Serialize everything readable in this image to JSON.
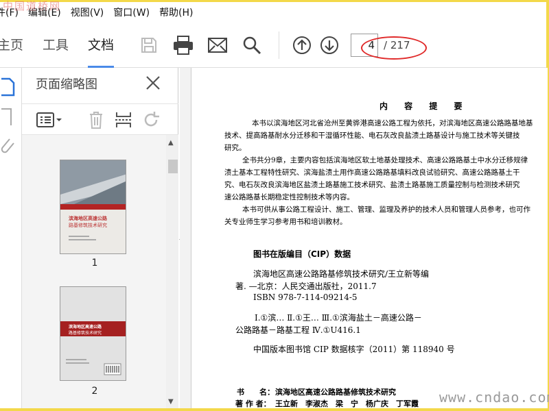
{
  "watermark_top": "中国道桥网",
  "watermark_bottom": "www.cndao.com",
  "menu": [
    "件(F)",
    "编辑(E)",
    "视图(V)",
    "窗口(W)",
    "帮助(H)"
  ],
  "tabs": {
    "home": "主页",
    "tools": "工具",
    "document": "文档"
  },
  "page_nav": {
    "current": "4",
    "total": "/ 217"
  },
  "panel": {
    "title": "页面缩略图"
  },
  "thumbnails": [
    {
      "label": "1",
      "title_line1": "滨海地区高速公路",
      "title_line2": "路基修筑技术研究"
    },
    {
      "label": "2",
      "title_line1": "滨海地区高速公路",
      "title_line2": "路基修筑技术研究"
    }
  ],
  "doc": {
    "heading": "内 容 提 要",
    "paras": [
      "本书以滨海地区河北省沧州至黄骅港高速公路工程为依托，对滨海地区高速公路路基地基",
      "技术、提高路基耐水分迁移和干湿循环性能、电石灰改良盐渍土路基设计与施工技术等关键技",
      "研究。",
      "全书共分9章，主要内容包括滨海地区软土地基处理技术、高速公路路基土中水分迁移规律",
      "渍土基本工程特性研究、滨海盐渍土用作高速公路路基填料改良试验研究、高速公路路基土干",
      "究、电石灰改良滨海地区盐渍土路基施工技术研究、盐渍土路基施工质量控制与检测技术研究",
      "速公路路基长期稳定性控制技术等内容。",
      "本书可供从事公路工程设计、施工、管理、监理及养护的技术人员和管理人员参考，也可作",
      "关专业师生学习参考用书和培训教材。"
    ],
    "cip_heading": "图书在版编目（CIP）数据",
    "cip_lines": [
      "滨海地区高速公路路基修筑技术研究/王立新等编",
      "著. —北京：人民交通出版社，2011.7",
      "ISBN 978-7-114-09214-5",
      "Ⅰ.①滨…  Ⅱ.①王…  Ⅲ.①滨海盐土－高速公路－",
      "公路路基－路基工程   Ⅳ.①U416.1",
      "中国版本图书馆 CIP 数据核字（2011）第 118940 号"
    ],
    "book_name_label": "书　　名：",
    "book_name": "滨海地区高速公路路基修筑技术研究",
    "authors_label": "著 作 者：",
    "authors": "王立新　李淑杰　梁　宁　杨广庆　丁军霞"
  }
}
